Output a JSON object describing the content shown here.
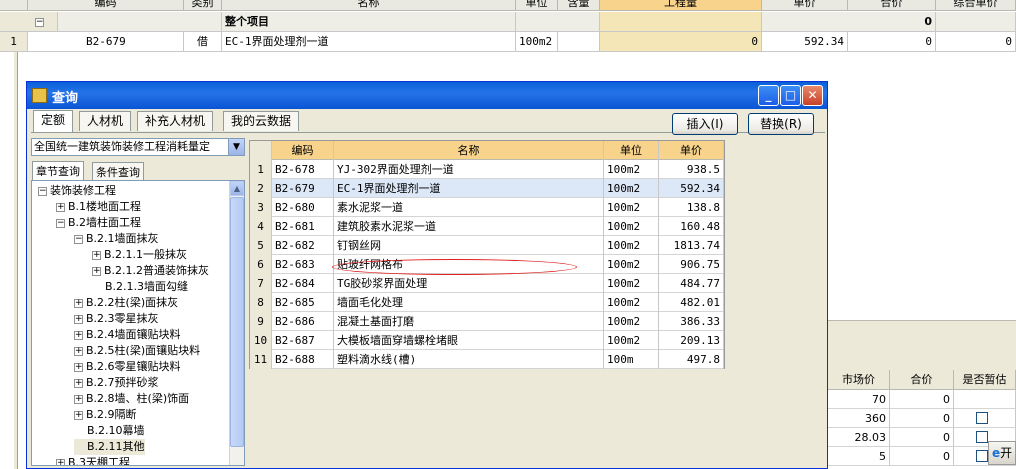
{
  "bg_table": {
    "headers": [
      "编码",
      "类别",
      "名称",
      "单位",
      "含量",
      "工程量",
      "单价",
      "合价",
      "综合单价"
    ],
    "group_row": {
      "toggle": "−",
      "name": "整个项目",
      "total": "0"
    },
    "row1": {
      "idx": "1",
      "code": "B2-679",
      "type": "借",
      "name": "EC-1界面处理剂一道",
      "unit": "100m2",
      "quantity": "0",
      "price": "592.34",
      "total": "0",
      "composite": "0"
    }
  },
  "dialog": {
    "title": "查询",
    "tabs": [
      "定额",
      "人材机",
      "补充人材机",
      "我的云数据"
    ],
    "buttons": {
      "insert": "插入(I)",
      "replace": "替换(R)"
    },
    "combo_value": "全国统一建筑装饰装修工程消耗量定",
    "subtabs": [
      "章节查询",
      "条件查询"
    ],
    "tree": [
      {
        "level": 0,
        "pm": "−",
        "label": "装饰装修工程"
      },
      {
        "level": 1,
        "pm": "+",
        "label": "B.1楼地面工程"
      },
      {
        "level": 1,
        "pm": "−",
        "label": "B.2墙柱面工程"
      },
      {
        "level": 2,
        "pm": "−",
        "label": "B.2.1墙面抹灰"
      },
      {
        "level": 3,
        "pm": "+",
        "label": "B.2.1.1一般抹灰"
      },
      {
        "level": 3,
        "pm": "+",
        "label": "B.2.1.2普通装饰抹灰"
      },
      {
        "level": 3,
        "pm": "",
        "label": "B.2.1.3墙面勾缝"
      },
      {
        "level": 2,
        "pm": "+",
        "label": "B.2.2柱(梁)面抹灰"
      },
      {
        "level": 2,
        "pm": "+",
        "label": "B.2.3零星抹灰"
      },
      {
        "level": 2,
        "pm": "+",
        "label": "B.2.4墙面镶贴块料"
      },
      {
        "level": 2,
        "pm": "+",
        "label": "B.2.5柱(梁)面镶贴块料"
      },
      {
        "level": 2,
        "pm": "+",
        "label": "B.2.6零星镶贴块料"
      },
      {
        "level": 2,
        "pm": "+",
        "label": "B.2.7预拌砂浆"
      },
      {
        "level": 2,
        "pm": "+",
        "label": "B.2.8墙、柱(梁)饰面"
      },
      {
        "level": 2,
        "pm": "+",
        "label": "B.2.9隔断"
      },
      {
        "level": 2,
        "pm": "",
        "label": "B.2.10幕墙"
      },
      {
        "level": 2,
        "pm": "",
        "label": "B.2.11其他"
      },
      {
        "level": 1,
        "pm": "+",
        "label": "B.3天棚工程"
      }
    ],
    "grid_headers": [
      "编码",
      "名称",
      "单位",
      "单价"
    ],
    "grid_rows": [
      {
        "idx": "1",
        "code": "B2-678",
        "name": "YJ-302界面处理剂一道",
        "unit": "100m2",
        "price": "938.5"
      },
      {
        "idx": "2",
        "code": "B2-679",
        "name": "EC-1界面处理剂一道",
        "unit": "100m2",
        "price": "592.34"
      },
      {
        "idx": "3",
        "code": "B2-680",
        "name": "素水泥浆一道",
        "unit": "100m2",
        "price": "138.8"
      },
      {
        "idx": "4",
        "code": "B2-681",
        "name": "建筑胶素水泥浆一道",
        "unit": "100m2",
        "price": "160.48"
      },
      {
        "idx": "5",
        "code": "B2-682",
        "name": "钉钢丝网",
        "unit": "100m2",
        "price": "1813.74"
      },
      {
        "idx": "6",
        "code": "B2-683",
        "name": "贴玻纤网格布",
        "unit": "100m2",
        "price": "906.75"
      },
      {
        "idx": "7",
        "code": "B2-684",
        "name": "TG胶砂浆界面处理",
        "unit": "100m2",
        "price": "484.77"
      },
      {
        "idx": "8",
        "code": "B2-685",
        "name": "墙面毛化处理",
        "unit": "100m2",
        "price": "482.01"
      },
      {
        "idx": "9",
        "code": "B2-686",
        "name": "混凝土基面打磨",
        "unit": "100m2",
        "price": "386.33"
      },
      {
        "idx": "10",
        "code": "B2-687",
        "name": "大模板墙面穿墙螺栓堵眼",
        "unit": "100m2",
        "price": "209.13"
      },
      {
        "idx": "11",
        "code": "B2-688",
        "name": "塑料滴水线(槽)",
        "unit": "100m",
        "price": "497.8"
      }
    ]
  },
  "right_panel": {
    "headers": [
      "市场价",
      "合价",
      "是否暂估"
    ],
    "rows": [
      {
        "market": "70",
        "total": "0"
      },
      {
        "market": "360",
        "total": "0"
      },
      {
        "market": "28.03",
        "total": "0"
      },
      {
        "market": "5",
        "total": "0"
      }
    ],
    "task_label": "开"
  }
}
